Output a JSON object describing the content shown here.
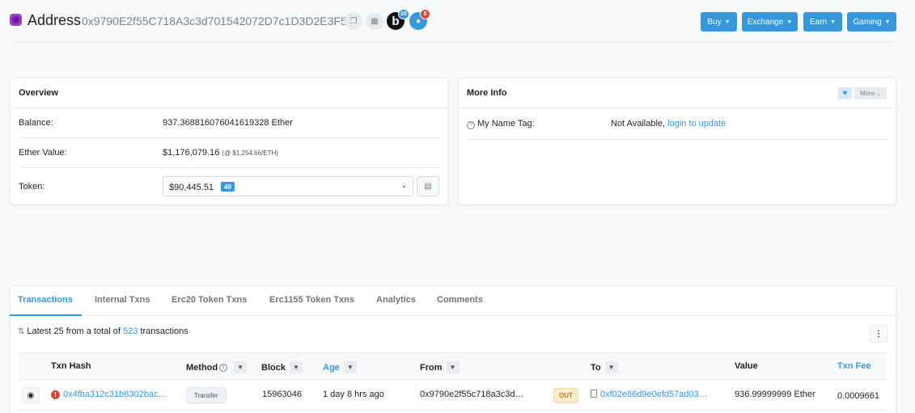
{
  "header": {
    "title": "Address",
    "address": "0x9790E2f55C718A3c3d701542072D7c1D3D2E3F5f",
    "b_badge": "10",
    "chat_badge": "8",
    "buttons": [
      {
        "label": "Buy"
      },
      {
        "label": "Exchange"
      },
      {
        "label": "Earn"
      },
      {
        "label": "Gaming"
      }
    ]
  },
  "overview": {
    "title": "Overview",
    "balance_label": "Balance:",
    "balance_value": "937.368816076041619328 Ether",
    "ether_value_label": "Ether Value:",
    "ether_value": "$1,176,079.16",
    "ether_price": "(@ $1,254.66/ETH)",
    "token_label": "Token:",
    "token_value": "$90,445.51",
    "token_count": "49"
  },
  "more_info": {
    "title": "More Info",
    "more_label": "More",
    "name_tag_label": "My Name Tag:",
    "name_tag_value": "Not Available,",
    "name_tag_link": "login to update"
  },
  "tabs": [
    {
      "label": "Transactions",
      "active": true
    },
    {
      "label": "Internal Txns"
    },
    {
      "label": "Erc20 Token Txns"
    },
    {
      "label": "Erc1155 Token Txns"
    },
    {
      "label": "Analytics"
    },
    {
      "label": "Comments"
    }
  ],
  "summary": {
    "prefix": "Latest 25 from a total of",
    "count": "523",
    "suffix": "transactions"
  },
  "table": {
    "headers": {
      "txn_hash": "Txn Hash",
      "method": "Method",
      "block": "Block",
      "age": "Age",
      "from": "From",
      "to": "To",
      "value": "Value",
      "txn_fee": "Txn Fee"
    },
    "rows": [
      {
        "txn_hash": "0x4fba312c31b8302bac…",
        "method": "Transfer",
        "block": "15963046",
        "age": "1 day 8 hrs ago",
        "from": "0x9790e2f55c718a3c3d…",
        "direction": "OUT",
        "to": "0xf02e86d9e0efd57ad03…",
        "value": "936.99999999 Ether",
        "txn_fee": "0.0009661"
      }
    ]
  },
  "colors": {
    "accent": "#3498db",
    "error": "#de4437",
    "out_badge": "#fbeccf"
  }
}
